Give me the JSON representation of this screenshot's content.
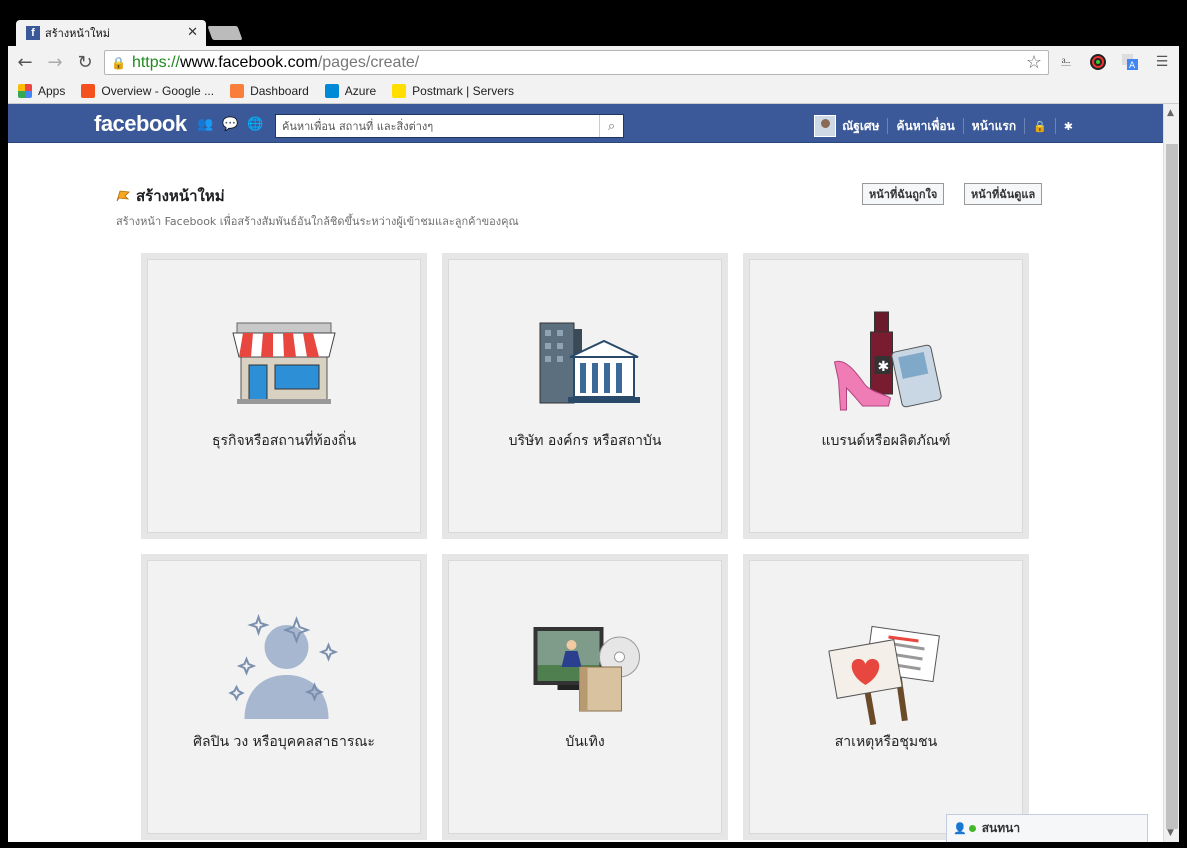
{
  "browser": {
    "tab_title": "สร้างหน้าใหม่",
    "url_scheme": "https://",
    "url_host": "www.facebook.com",
    "url_path": "/pages/create/",
    "bookmarks": [
      {
        "label": "Apps",
        "color": "#e44"
      },
      {
        "label": "Overview - Google ...",
        "color": "#f4511e"
      },
      {
        "label": "Dashboard",
        "color": "#f97e3b"
      },
      {
        "label": "Azure",
        "color": "#0089d6"
      },
      {
        "label": "Postmark | Servers",
        "color": "#ffde00"
      }
    ]
  },
  "fb": {
    "logo": "facebook",
    "search_placeholder": "ค้นหาเพื่อน สถานที่ และสิ่งต่างๆ",
    "user_name": "ณัฐเศษ",
    "find_friends": "ค้นหาเพื่อน",
    "home": "หน้าแรก",
    "brand_color": "#3b5998"
  },
  "page": {
    "title": "สร้างหน้าใหม่",
    "subtitle": "สร้างหน้า Facebook เพื่อสร้างสัมพันธ์อันใกล้ชิดขึ้นระหว่างผู้เข้าชมและลูกค้าของคุณ",
    "liked_pages_button": "หน้าที่ฉันถูกใจ",
    "managed_pages_button": "หน้าที่ฉันดูแล"
  },
  "categories": [
    {
      "label": "ธุรกิจหรือสถานที่ท้องถิ่น",
      "icon": "storefront-icon"
    },
    {
      "label": "บริษัท องค์กร หรือสถาบัน",
      "icon": "buildings-icon"
    },
    {
      "label": "แบรนด์หรือผลิตภัณฑ์",
      "icon": "products-icon"
    },
    {
      "label": "ศิลปิน วง หรือบุคคลสาธารณะ",
      "icon": "public-figure-icon"
    },
    {
      "label": "บันเทิง",
      "icon": "entertainment-icon"
    },
    {
      "label": "สาเหตุหรือชุมชน",
      "icon": "cause-signs-icon"
    }
  ],
  "chat": {
    "label": "สนทนา"
  }
}
